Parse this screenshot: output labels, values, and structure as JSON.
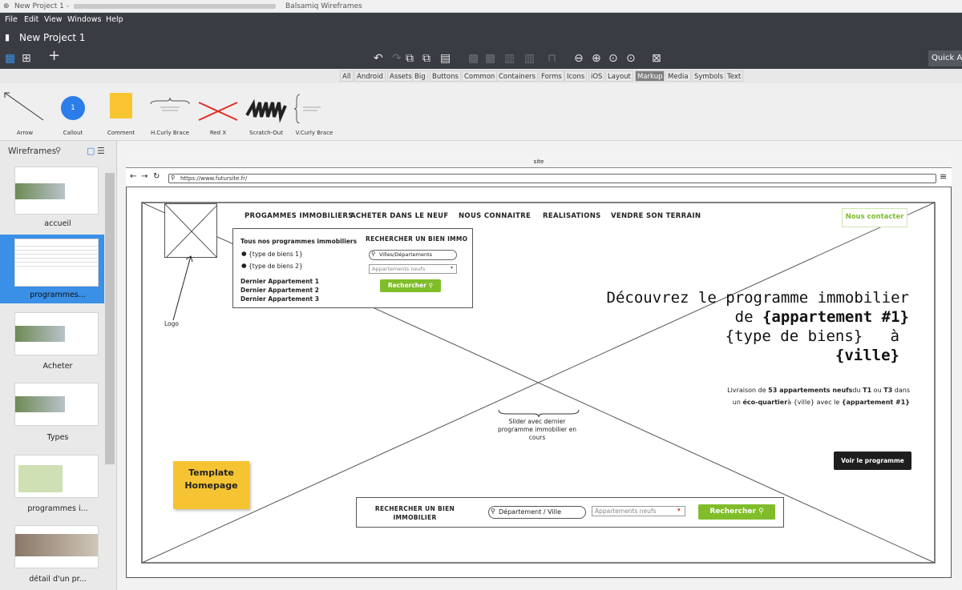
{
  "window": {
    "title": "New Project 1 - ",
    "app_name": "Balsamiq Wireframes"
  },
  "menu": [
    "File",
    "Edit",
    "View",
    "Windows",
    "Help"
  ],
  "project_name": "New Project 1",
  "quick_add": "Quick A",
  "categories": [
    "All",
    "Android",
    "Assets",
    "Big",
    "Buttons",
    "Common",
    "Containers",
    "Forms",
    "Icons",
    "iOS",
    "Layout",
    "Markup",
    "Media",
    "Symbols",
    "Text"
  ],
  "active_category": "Markup",
  "library": [
    {
      "name": "Arrow"
    },
    {
      "name": "Callout",
      "number": "1"
    },
    {
      "name": "Comment"
    },
    {
      "name": "H.Curly Brace"
    },
    {
      "name": "Red X"
    },
    {
      "name": "Scratch-Out"
    },
    {
      "name": "V.Curly Brace"
    }
  ],
  "navigator": {
    "header": "Wireframes",
    "pages": [
      "accueil",
      "programmes...",
      "Acheter",
      "Types",
      "programmes i...",
      "détail d'un pr..."
    ],
    "selected": 1
  },
  "mockup": {
    "window_title": "site",
    "url": "https://www.futursite.fr/",
    "nav_links": [
      "PROGAMMES IMMOBILIERS",
      "ACHETER DANS LE NEUF",
      "NOUS CONNAITRE",
      "REALISATIONS",
      "VENDRE SON TERRAIN"
    ],
    "contact_button": "Nous contacter",
    "logo_label": "Logo",
    "dropdown": {
      "heading_left": "Tous nos programmes immobiliers",
      "bullets": [
        "{type de biens 1}",
        "{type de biens 2}"
      ],
      "recent": [
        "Dernier Appartement 1",
        "Dernier Appartement 2",
        "Dernier Appartement 3"
      ],
      "heading_right": "RECHERCHER UN BIEN IMMO",
      "search_placeholder": "Villes/Départements",
      "select_placeholder": "Appartements neufs",
      "search_button": "Rechercher"
    },
    "hero": {
      "line1": "Découvrez le programme immobilier",
      "line2_prefix": "de ",
      "line2_bold": "{appartement #1}",
      "line3": "{type de biens}",
      "line3_suffix": "à",
      "line4": "{ville}"
    },
    "livraison": {
      "p1": "Livraison de ",
      "b1": "53 appartements neufs",
      "p2": "du ",
      "b2": "T1",
      "p3": " ou ",
      "b3": "T3",
      "p4": " dans",
      "p5": "un ",
      "b4": "éco-quartier",
      "p6": "à {ville} avec le ",
      "b5": "{appartement #1}"
    },
    "slider_note": "Slider avec dernier programme immobilier en cours",
    "voir_button": "Voir le programme",
    "sticky_note": "Template Homepage",
    "searchbar": {
      "title": "RECHERCHER UN BIEN IMMOBILIER",
      "input_placeholder": "Département / Ville",
      "select_placeholder": "Appartements neufs",
      "button": "Rechercher"
    }
  },
  "colors": {
    "toolbar": "#393c43",
    "accent_blue": "#3a8fe6",
    "green": "#81bd2a",
    "sticky": "#f6c432"
  }
}
